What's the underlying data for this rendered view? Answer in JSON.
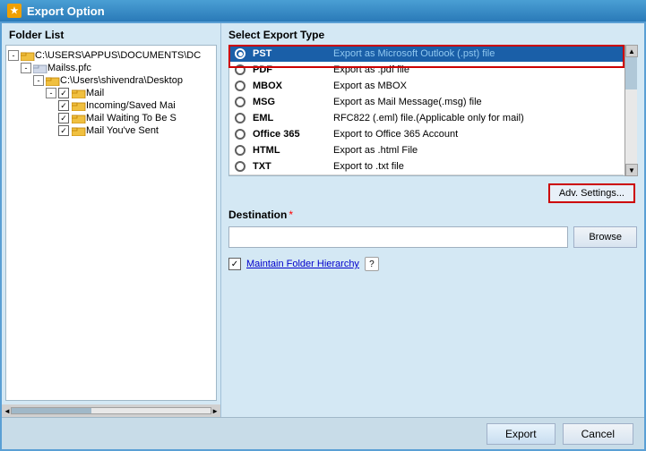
{
  "titleBar": {
    "icon": "★",
    "title": "Export Option"
  },
  "folderPanel": {
    "label": "Folder List",
    "tree": [
      {
        "id": "root",
        "indent": 0,
        "expand": "-",
        "checkbox": false,
        "icon": "folder",
        "label": "C:\\USERS\\APPUS\\DOCUMENTS\\DC",
        "hasCheckbox": false
      },
      {
        "id": "mailss",
        "indent": 1,
        "expand": "-",
        "checkbox": false,
        "icon": "pfc",
        "label": "Mailss.pfc",
        "hasCheckbox": false
      },
      {
        "id": "shivendra",
        "indent": 2,
        "expand": "-",
        "checkbox": false,
        "icon": "folder",
        "label": "C:\\Users\\shivendra\\Desktop",
        "hasCheckbox": false
      },
      {
        "id": "mail",
        "indent": 3,
        "expand": "-",
        "checkbox": true,
        "checked": true,
        "icon": "folder",
        "label": "Mail",
        "hasCheckbox": true
      },
      {
        "id": "incoming",
        "indent": 4,
        "expand": null,
        "checkbox": true,
        "checked": true,
        "icon": "folder",
        "label": "Incoming/Saved Mai",
        "hasCheckbox": true
      },
      {
        "id": "waiting",
        "indent": 4,
        "expand": null,
        "checkbox": true,
        "checked": true,
        "icon": "folder",
        "label": "Mail Waiting To Be S",
        "hasCheckbox": true
      },
      {
        "id": "sent",
        "indent": 4,
        "expand": null,
        "checkbox": true,
        "checked": true,
        "icon": "folder",
        "label": "Mail You've Sent",
        "hasCheckbox": true
      }
    ]
  },
  "exportPanel": {
    "label": "Select Export Type",
    "options": [
      {
        "id": "pst",
        "type": "PST",
        "desc": "Export as Microsoft Outlook (.pst) file",
        "selected": true
      },
      {
        "id": "pdf",
        "type": "PDF",
        "desc": "Export as .pdf file",
        "selected": false
      },
      {
        "id": "mbox",
        "type": "MBOX",
        "desc": "Export as MBOX",
        "selected": false
      },
      {
        "id": "msg",
        "type": "MSG",
        "desc": "Export as Mail Message(.msg) file",
        "selected": false
      },
      {
        "id": "eml",
        "type": "EML",
        "desc": "RFC822 (.eml) file.(Applicable only for mail)",
        "selected": false
      },
      {
        "id": "o365",
        "type": "Office 365",
        "desc": "Export to Office 365 Account",
        "selected": false
      },
      {
        "id": "html",
        "type": "HTML",
        "desc": "Export as .html File",
        "selected": false
      },
      {
        "id": "txt",
        "type": "TXT",
        "desc": "Export to .txt file",
        "selected": false
      }
    ]
  },
  "advSettings": {
    "label": "Adv. Settings..."
  },
  "destination": {
    "label": "Destination",
    "required": true,
    "placeholder": "",
    "browseLabel": "Browse"
  },
  "maintain": {
    "checked": true,
    "label": "Maintain Folder Hierarchy",
    "helpLabel": "?"
  },
  "footer": {
    "exportLabel": "Export",
    "cancelLabel": "Cancel"
  }
}
